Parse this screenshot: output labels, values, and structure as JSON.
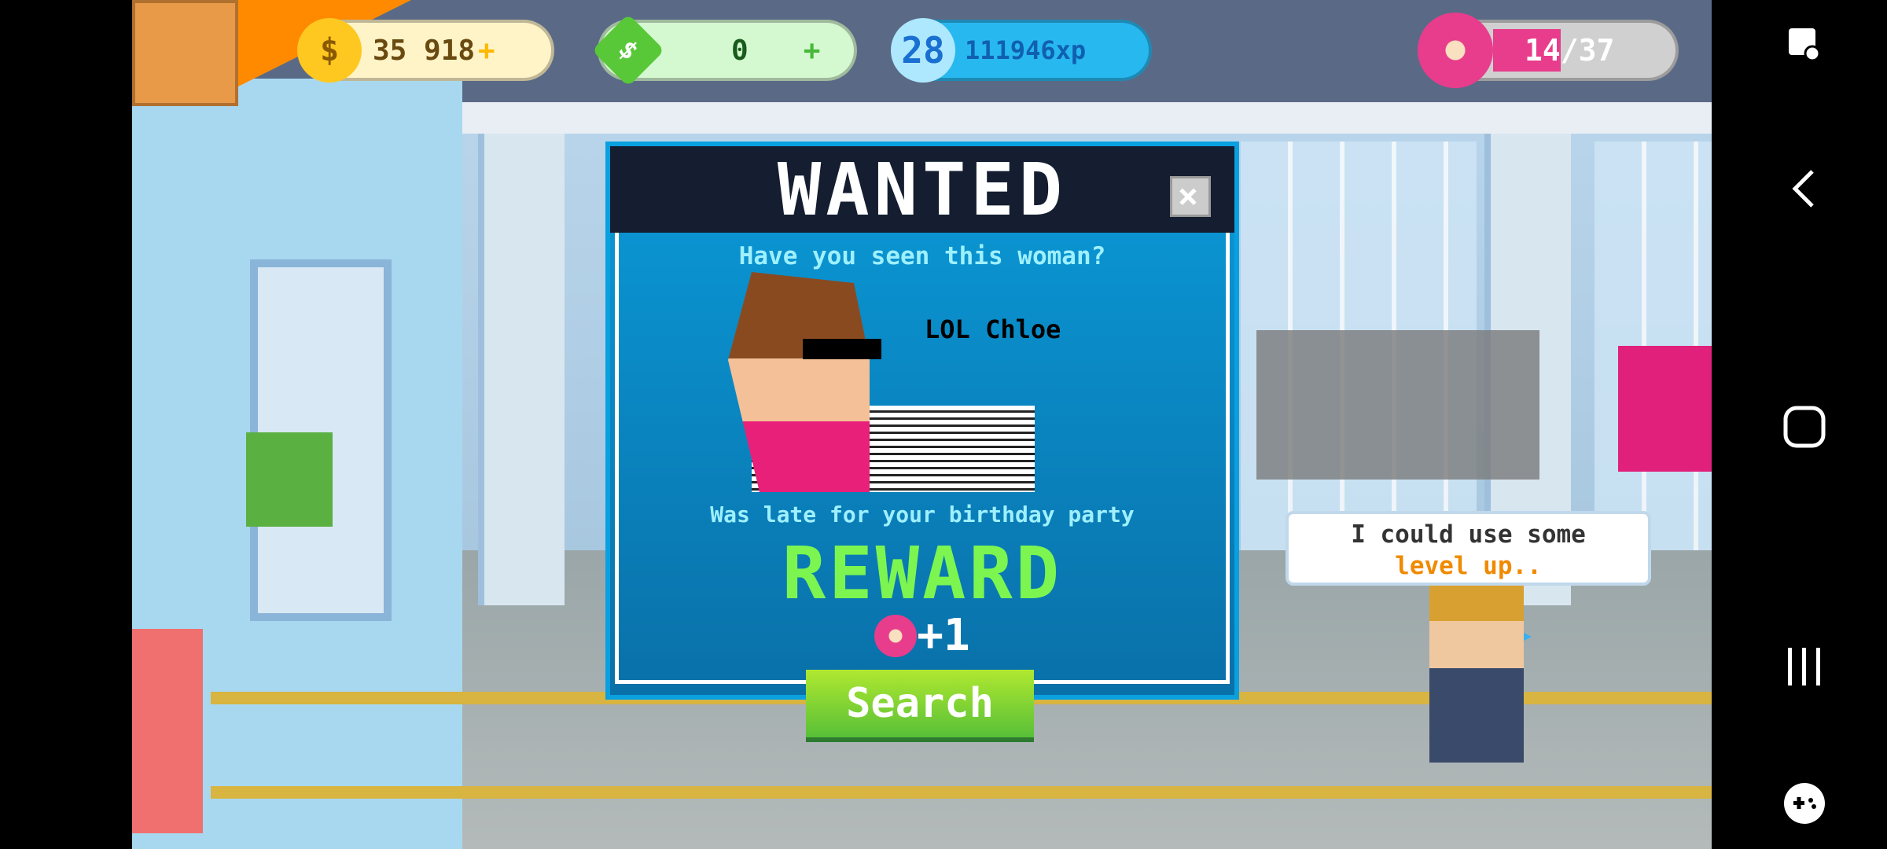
{
  "hud": {
    "coins": "35 918",
    "cash": "0",
    "level": "28",
    "xp": "111946xp",
    "donuts": "14/37",
    "donut_fraction": 0.378,
    "plus": "+"
  },
  "modal": {
    "title": "WANTED",
    "close": "×",
    "question": "Have you seen this woman?",
    "name": "LOL Chloe",
    "description": "Was late for your birthday party",
    "reward_title": "REWARD",
    "reward_amount": "+1",
    "search_button": "Search"
  },
  "speech": {
    "line1": "I could use some",
    "line2": "level up.."
  },
  "colors": {
    "coin": "#ffc820",
    "cash": "#58c838",
    "xp": "#28b8f0",
    "donut": "#e83c8c",
    "reward": "#7cf550",
    "modal": "#0a88c8"
  }
}
